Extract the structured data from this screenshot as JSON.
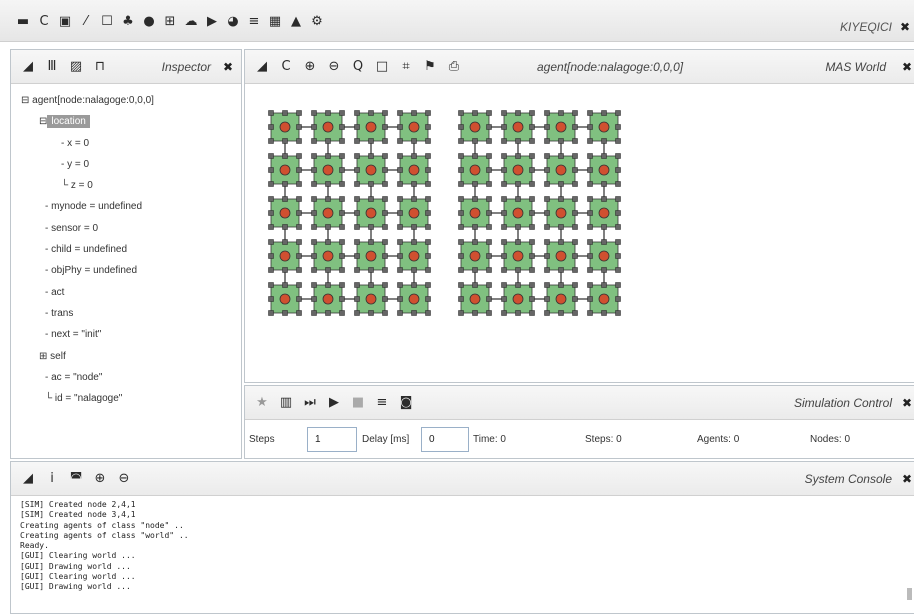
{
  "toolbar": {
    "icons": [
      "folder-icon",
      "reload-icon",
      "save-icon",
      "magic-icon",
      "edit-icon",
      "sitemap-icon",
      "info-icon",
      "table-icon",
      "cloud-icon",
      "play-icon",
      "pie-chart-icon",
      "menu-icon",
      "grid-icon",
      "lock-icon",
      "network-icon"
    ],
    "app_title": "KIYEQICI"
  },
  "inspector": {
    "title": "Inspector",
    "tree": {
      "root": "agent[node:nalagoge:0,0,0]",
      "location": "location",
      "x": "x = 0",
      "y": "y = 0",
      "z": "z = 0",
      "mynode": "mynode = undefined",
      "sensor": "sensor = 0",
      "child": "child = undefined",
      "objPhy": "objPhy = undefined",
      "act": "act",
      "trans": "trans",
      "next": "next = \"init\"",
      "self": "self",
      "ac": "ac = \"node\"",
      "id": "id = \"nalagoge\""
    }
  },
  "world": {
    "agent_label": "agent[node:nalagoge:0,0,0]",
    "title": "MAS World",
    "colors": {
      "node_fill": "#80c080",
      "agent_dot": "#d05030"
    },
    "grids": [
      {
        "cols": 4,
        "rows": 5
      },
      {
        "cols": 4,
        "rows": 5
      }
    ]
  },
  "sim": {
    "title": "Simulation Control",
    "steps_label": "Steps",
    "steps_value": "1",
    "delay_label": "Delay [ms]",
    "delay_value": "0",
    "time": "Time: 0",
    "steps_status": "Steps: 0",
    "agents": "Agents: 0",
    "nodes": "Nodes: 0"
  },
  "console": {
    "title": "System Console",
    "lines": [
      "[SIM] Created node 2,4,1",
      "[SIM] Created node 3,4,1",
      "Creating agents of class \"node\" ..",
      "Creating agents of class \"world\" ..",
      "Ready.",
      "[GUI] Clearing world ...",
      "[GUI] Drawing world ...",
      "[GUI] Clearing world ...",
      "[GUI] Drawing world ..."
    ]
  }
}
